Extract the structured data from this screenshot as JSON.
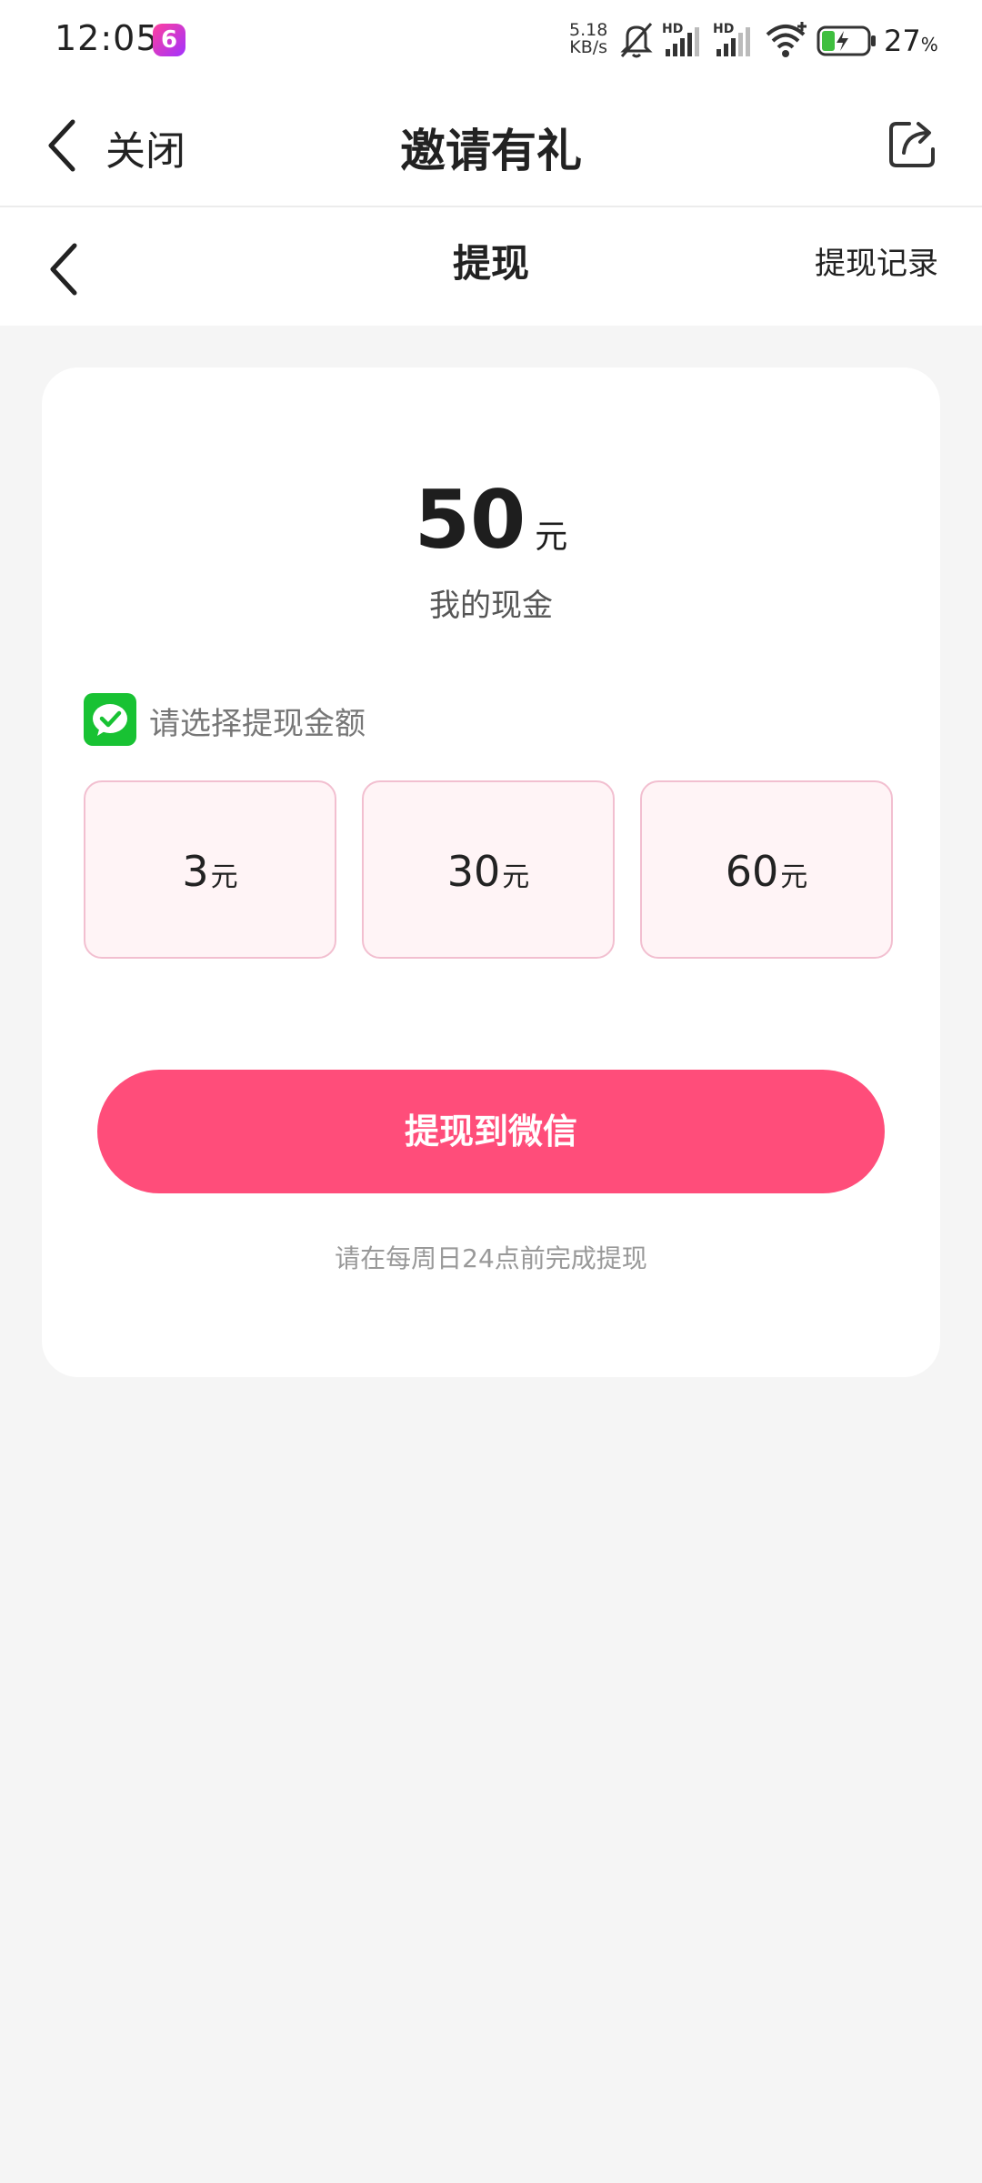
{
  "status_bar": {
    "time": "12:05",
    "app_badge": "6",
    "net_speed_value": "5.18",
    "net_speed_unit": "KB/s",
    "signal1_label": "HD",
    "signal2_label": "HD",
    "battery_percent": "27",
    "battery_unit": "%"
  },
  "top_bar": {
    "close_label": "关闭",
    "title": "邀请有礼"
  },
  "sub_bar": {
    "title": "提现",
    "record_label": "提现记录"
  },
  "card": {
    "amount": "50",
    "amount_unit": "元",
    "amount_label": "我的现金",
    "select_label": "请选择提现金额",
    "options": [
      {
        "value": "3",
        "unit": "元"
      },
      {
        "value": "30",
        "unit": "元"
      },
      {
        "value": "60",
        "unit": "元"
      }
    ],
    "withdraw_button": "提现到微信",
    "hint": "请在每周日24点前完成提现"
  },
  "colors": {
    "accent": "#ff4d7a",
    "option_bg": "#fff4f6",
    "option_border": "#f2bfd0",
    "wechat_green": "#18c233",
    "page_bg": "#f5f5f5"
  },
  "icons": {
    "back": "chevron-left-icon",
    "share": "share-icon",
    "wechat": "wechat-icon",
    "mute": "bell-off-icon",
    "wifi": "wifi-icon",
    "battery": "battery-icon"
  }
}
